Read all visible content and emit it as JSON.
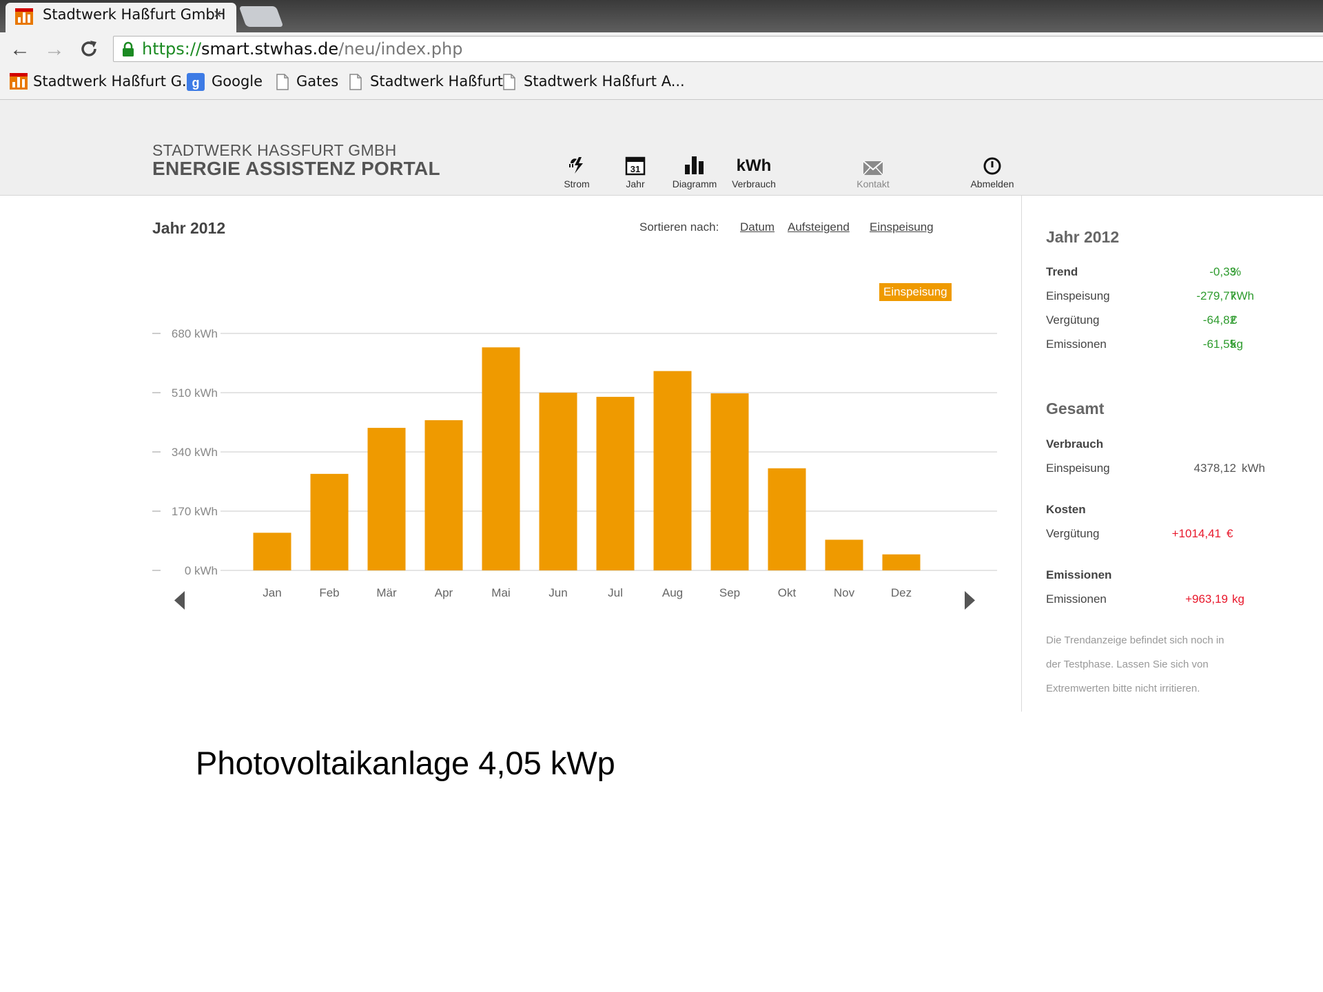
{
  "browser": {
    "tab_title": "Stadtwerk Haßfurt GmbH",
    "tab_close": "×",
    "url_scheme": "https://",
    "url_host": "smart.stwhas.de",
    "url_path": "/neu/index.php",
    "bookmarks": [
      {
        "label": "Stadtwerk Haßfurt G...",
        "icon": "stadtwerk-favicon"
      },
      {
        "label": "Google",
        "icon": "google-icon"
      },
      {
        "label": "Gates",
        "icon": "page-icon"
      },
      {
        "label": "Stadtwerk Haßfurt",
        "icon": "page-icon"
      },
      {
        "label": "Stadtwerk Haßfurt A...",
        "icon": "page-icon"
      }
    ]
  },
  "header": {
    "company": "STADTWERK HASSFURT GMBH",
    "portal": "ENERGIE ASSISTENZ PORTAL",
    "nav": [
      {
        "label": "Strom",
        "icon": "strom-icon"
      },
      {
        "label": "Jahr",
        "icon": "calendar-icon",
        "icon_text": "31"
      },
      {
        "label": "Diagramm",
        "icon": "bar-chart-icon"
      },
      {
        "label": "Verbrauch",
        "icon": "kwh-icon",
        "icon_text": "kWh"
      },
      {
        "label": "Kontakt",
        "icon": "mail-icon"
      },
      {
        "label": "Abmelden",
        "icon": "power-icon"
      }
    ]
  },
  "main": {
    "title": "Jahr 2012",
    "sort_label": "Sortieren nach:",
    "sort_links": [
      "Datum",
      "Aufsteigend",
      "Einspeisung"
    ],
    "legend": "Einspeisung"
  },
  "chart_data": {
    "type": "bar",
    "categories": [
      "Jan",
      "Feb",
      "Mär",
      "Apr",
      "Mai",
      "Jun",
      "Jul",
      "Aug",
      "Sep",
      "Okt",
      "Nov",
      "Dez"
    ],
    "series": [
      {
        "name": "Einspeisung",
        "values": [
          108,
          277,
          409,
          431,
          640,
          510,
          498,
          572,
          508,
          293,
          88,
          46
        ],
        "color": "#ef9a00"
      }
    ],
    "ylim": [
      0,
      680
    ],
    "yticks": [
      0,
      170,
      340,
      510,
      680
    ],
    "ytick_labels": [
      "0 kWh",
      "170 kWh",
      "340 kWh",
      "510 kWh",
      "680 kWh"
    ],
    "grid": true,
    "legend_position": "top-right"
  },
  "sidebar": {
    "year": {
      "title": "Jahr 2012",
      "rows": [
        {
          "label": "Trend",
          "value": "-0,33",
          "unit": "%",
          "bold": true,
          "color": "green"
        },
        {
          "label": "Einspeisung",
          "value": "-279,77",
          "unit": "kWh",
          "color": "green"
        },
        {
          "label": "Vergütung",
          "value": "-64,82",
          "unit": "€",
          "color": "green"
        },
        {
          "label": "Emissionen",
          "value": "-61,55",
          "unit": "kg",
          "color": "green"
        }
      ]
    },
    "total": {
      "title": "Gesamt",
      "verbrauch_heading": "Verbrauch",
      "einspeisung_label": "Einspeisung",
      "einspeisung_value": "4378,12",
      "einspeisung_unit": "kWh",
      "kosten_heading": "Kosten",
      "verguetung_label": "Vergütung",
      "verguetung_value": "+1014,41",
      "verguetung_unit": "€",
      "emissionen_heading": "Emissionen",
      "emissionen_label": "Emissionen",
      "emissionen_value": "+963,19",
      "emissionen_unit": "kg"
    },
    "note_lines": [
      "Die Trendanzeige befindet sich noch in",
      "der Testphase. Lassen Sie sich von",
      "Extremwerten bitte nicht irritieren."
    ]
  },
  "caption": "Photovoltaikanlage 4,05 kWp"
}
